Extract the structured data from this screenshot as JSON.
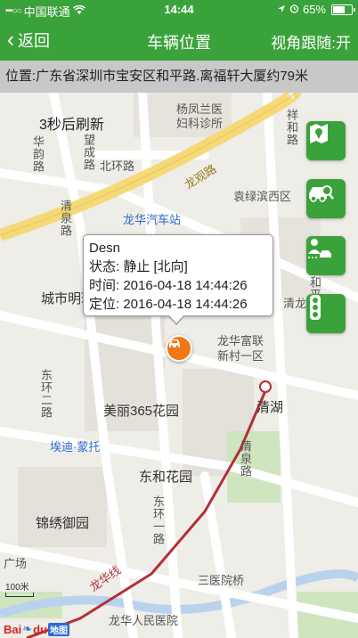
{
  "status_bar": {
    "signal_dots": "•••○○",
    "carrier": "中国联通",
    "wifi_icon": "wifi-icon",
    "time": "14:44",
    "battery": "65%",
    "battery_level": 0.65
  },
  "nav": {
    "back_label": "返回",
    "title": "车辆位置",
    "follow_label": "视角跟随:开"
  },
  "address": "位置:广东省深圳市宝安区和平路.离福轩大厦约79米",
  "map": {
    "refresh_text": "3秒后刷新",
    "labels": {
      "yangfenglan": "杨凤兰医",
      "clinic": "妇科诊所",
      "xiangli_road": "祥和路",
      "huaqian_road": "华韵路",
      "wangcheng_road": "望成路",
      "beihuan_road": "北环路",
      "longguan_road": "龙观路",
      "yuanlvbin": "袁绿滨西区",
      "qingquan_road": "清泉路",
      "bus_station": "龙华汽车站",
      "chengshimingzhu": "城市明珠",
      "longhua_fulian": "龙华富联",
      "xincun": "新村一区",
      "qinglong_road": "清龙路",
      "heping_road": "和平路",
      "dongdayi_road": "东环二路",
      "meili365": "美丽365花园",
      "qinghu": "清湖",
      "aidimengtuo": "埃迪·蒙托",
      "qingquan_road2": "清泉路",
      "donghe": "东和花园",
      "donghuan_road": "东环一路",
      "jinxiu": "锦绣御园",
      "guangchang": "广场",
      "longhua_line": "龙华线",
      "sanyiyuan": "三医院桥",
      "hospital": "龙华人民医院"
    }
  },
  "side_buttons": [
    "map-pin-icon",
    "car-search-icon",
    "person-car-icon",
    "traffic-light-icon"
  ],
  "popup": {
    "name": "Desn",
    "status": "状态: 静止 [北向]",
    "time": "时间: 2016-04-18 14:44:26",
    "locate": "定位: 2016-04-18 14:44:26"
  },
  "scale": "100米",
  "logo": {
    "bai": "Bai",
    "du": "du",
    "map": "地图"
  },
  "colors": {
    "brand_green": "#3aa23a",
    "marker_orange": "#f07814",
    "subway_red": "#b0303a"
  }
}
